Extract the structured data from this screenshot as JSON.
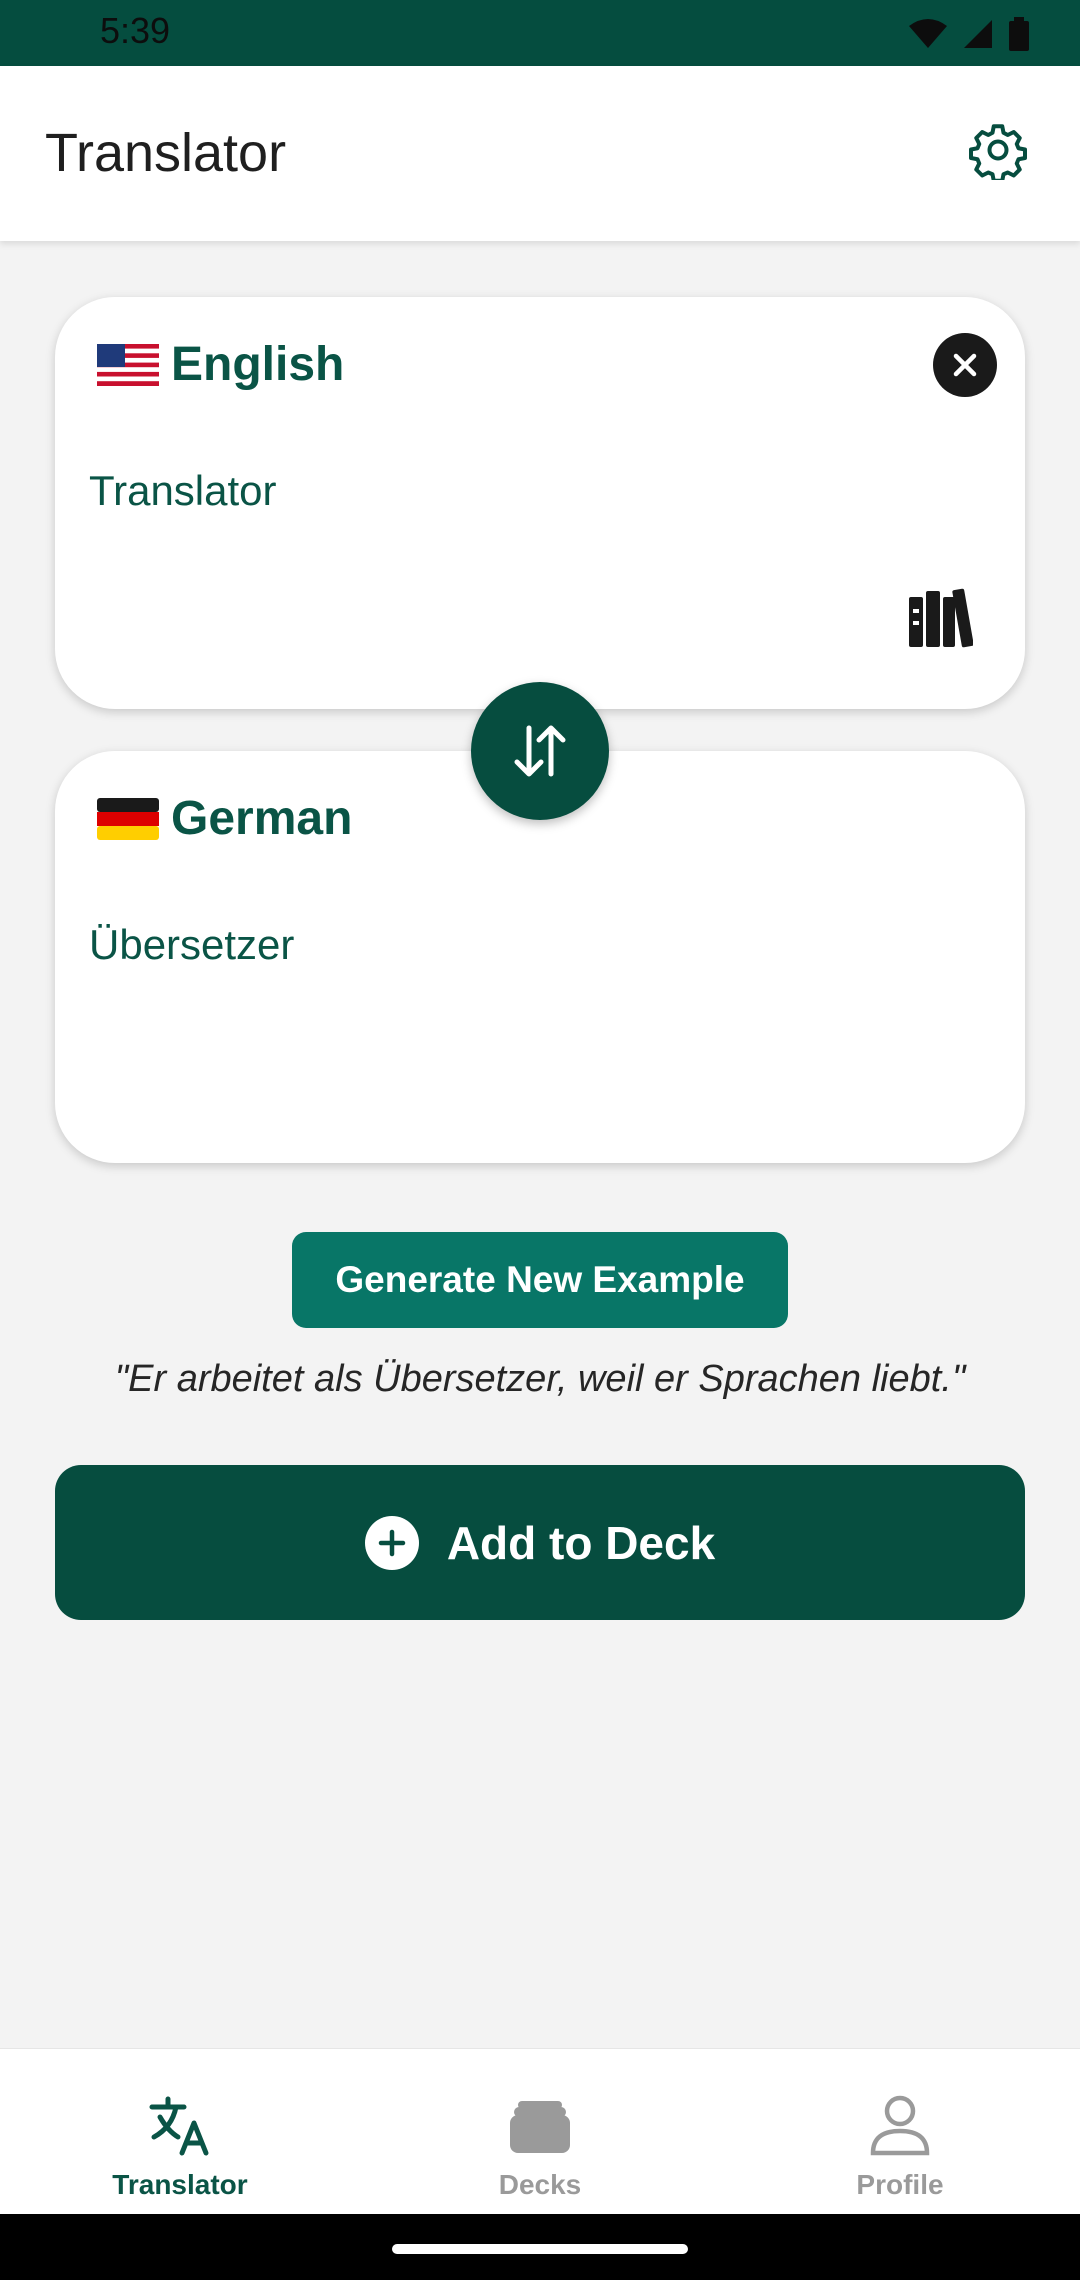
{
  "status_bar": {
    "time": "5:39",
    "icons": [
      "wifi-icon",
      "signal-icon",
      "battery-icon"
    ]
  },
  "app_bar": {
    "title": "Translator",
    "settings_icon": "gear-icon"
  },
  "source_card": {
    "flag": "us-flag-icon",
    "language": "English",
    "text": "Translator",
    "clear_icon": "close-icon",
    "library_icon": "library-icon"
  },
  "swap_button": {
    "icon": "swap-arrows-icon"
  },
  "target_card": {
    "flag": "de-flag-icon",
    "language": "German",
    "text": "Übersetzer"
  },
  "generate_button": {
    "label": "Generate New Example"
  },
  "example_sentence": "\"Er arbeitet als Übersetzer, weil er Sprachen liebt.\"",
  "add_button": {
    "label": "Add to Deck",
    "icon": "plus-circle-icon"
  },
  "bottom_nav": {
    "items": [
      {
        "label": "Translator",
        "icon": "translate-icon",
        "active": true
      },
      {
        "label": "Decks",
        "icon": "decks-icon",
        "active": false
      },
      {
        "label": "Profile",
        "icon": "person-icon",
        "active": false
      }
    ]
  },
  "colors": {
    "primary_dark": "#064d3f",
    "primary": "#087667",
    "text_primary": "#0a5446",
    "background": "#f3f3f3",
    "inactive": "#9a9a9a"
  }
}
